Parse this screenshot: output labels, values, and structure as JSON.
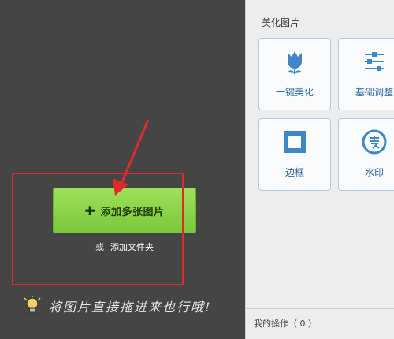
{
  "drop_area": {
    "add_button_icon": "plus-icon",
    "add_button_label": "添加多张图片",
    "or_text": "或",
    "add_folder_label": "添加文件夹",
    "hint_text": "将图片直接拖进来也行哦!",
    "hint_icon": "lightbulb-icon"
  },
  "panel": {
    "title": "美化图片",
    "tools": [
      {
        "label": "一键美化",
        "icon": "tulip-icon"
      },
      {
        "label": "基础调整",
        "icon": "sliders-icon"
      },
      {
        "label": "边框",
        "icon": "frame-icon"
      },
      {
        "label": "水印",
        "icon": "watermark-icon"
      }
    ],
    "operations_label": "我的操作（ 0 ）"
  },
  "colors": {
    "background": "#454545",
    "button_green": "#8fd64a",
    "annotation_red": "#e02a2a",
    "tool_blue": "#2f6aa3"
  }
}
